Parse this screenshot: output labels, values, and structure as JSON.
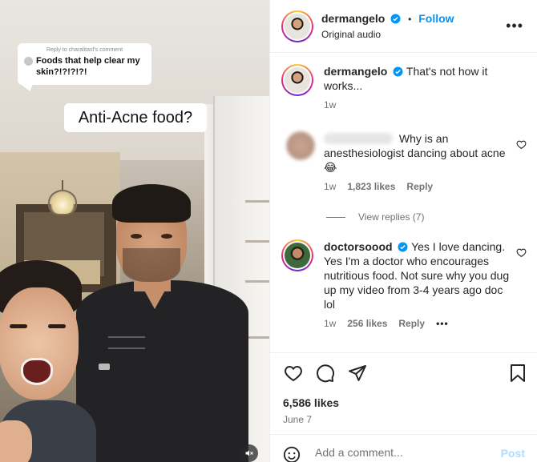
{
  "video": {
    "reply_meta": "Reply to charalitasf's comment",
    "reply_text": "Foods that help clear my skin?!?!?!?!",
    "caption": "Anti-Acne food?"
  },
  "header": {
    "username": "dermangelo",
    "follow_label": "Follow",
    "separator": "•",
    "subtitle": "Original audio",
    "more_label": "•••"
  },
  "post": {
    "username": "dermangelo",
    "text": "That's not how it works...",
    "time": "1w"
  },
  "comments": [
    {
      "username": "",
      "text": "Why is an anesthesiologist dancing about acne 😂",
      "time": "1w",
      "likes": "1,823 likes",
      "reply": "Reply"
    },
    {
      "username": "doctorsoood",
      "text": "Yes I love dancing. Yes I'm a doctor who encourages nutritious food. Not sure why you dug up my video from 3-4 years ago doc lol",
      "time": "1w",
      "likes": "256 likes",
      "reply": "Reply",
      "more": "•••"
    }
  ],
  "view_replies": "View replies (7)",
  "actions": {
    "likes": "6,586 likes",
    "date": "June 7"
  },
  "add_comment": {
    "placeholder": "Add a comment...",
    "post_label": "Post"
  },
  "colors": {
    "follow_blue": "#0095f6",
    "verified_blue": "#0095f6",
    "post_disabled": "#b3dbff",
    "meta_gray": "#737373"
  }
}
